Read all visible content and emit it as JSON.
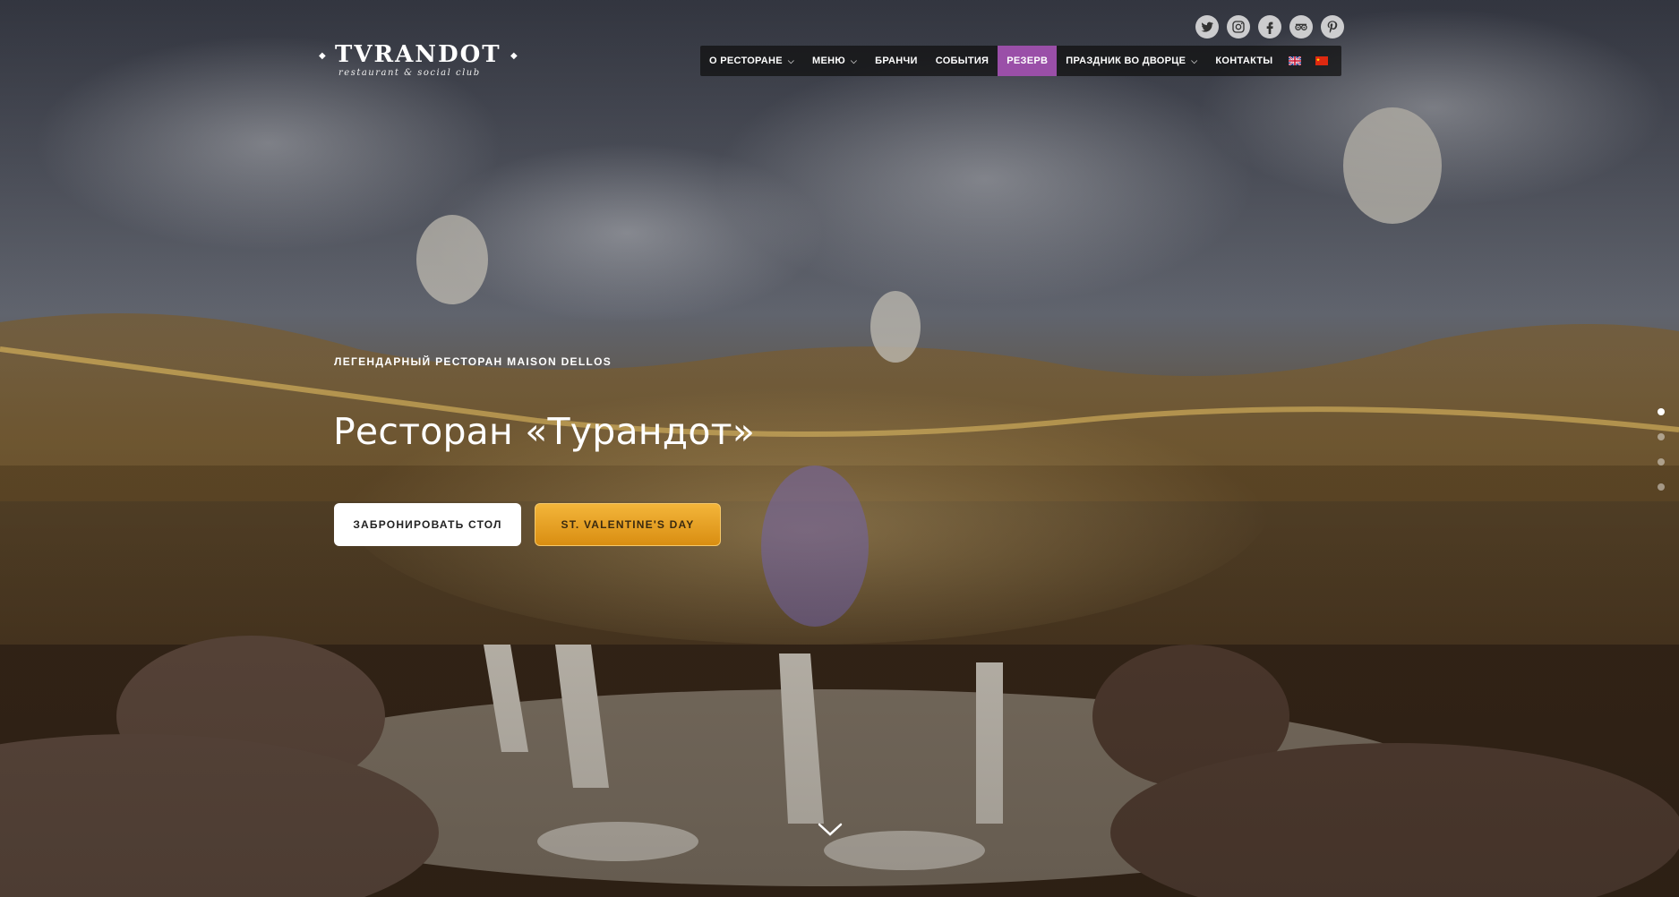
{
  "brand": {
    "name": "TVRANDOT",
    "tagline": "restaurant & social club"
  },
  "social": [
    "twitter-icon",
    "instagram-icon",
    "facebook-icon",
    "tripadvisor-icon",
    "pinterest-icon"
  ],
  "nav": {
    "items": [
      {
        "label": "О РЕСТОРАНЕ",
        "dropdown": true
      },
      {
        "label": "МЕНЮ",
        "dropdown": true
      },
      {
        "label": "БРАНЧИ",
        "dropdown": false
      },
      {
        "label": "СОБЫТИЯ",
        "dropdown": false
      },
      {
        "label": "РЕЗЕРВ",
        "dropdown": false,
        "active": true
      },
      {
        "label": "ПРАЗДНИК ВО ДВОРЦЕ",
        "dropdown": true
      },
      {
        "label": "КОНТАКТЫ",
        "dropdown": false
      }
    ],
    "active_color": "#9a4fa8"
  },
  "hero": {
    "eyebrow": "ЛЕГЕНДАРНЫЙ РЕСТОРАН MAISON DELLOS",
    "title": "Ресторан «Турандот»",
    "book_button": "ЗАБРОНИРОВАТЬ СТОЛ",
    "valentine_button": "ST. VALENTINE'S DAY",
    "accent_color": "#e9a62a"
  },
  "slider": {
    "slides": 4,
    "active": 1
  }
}
